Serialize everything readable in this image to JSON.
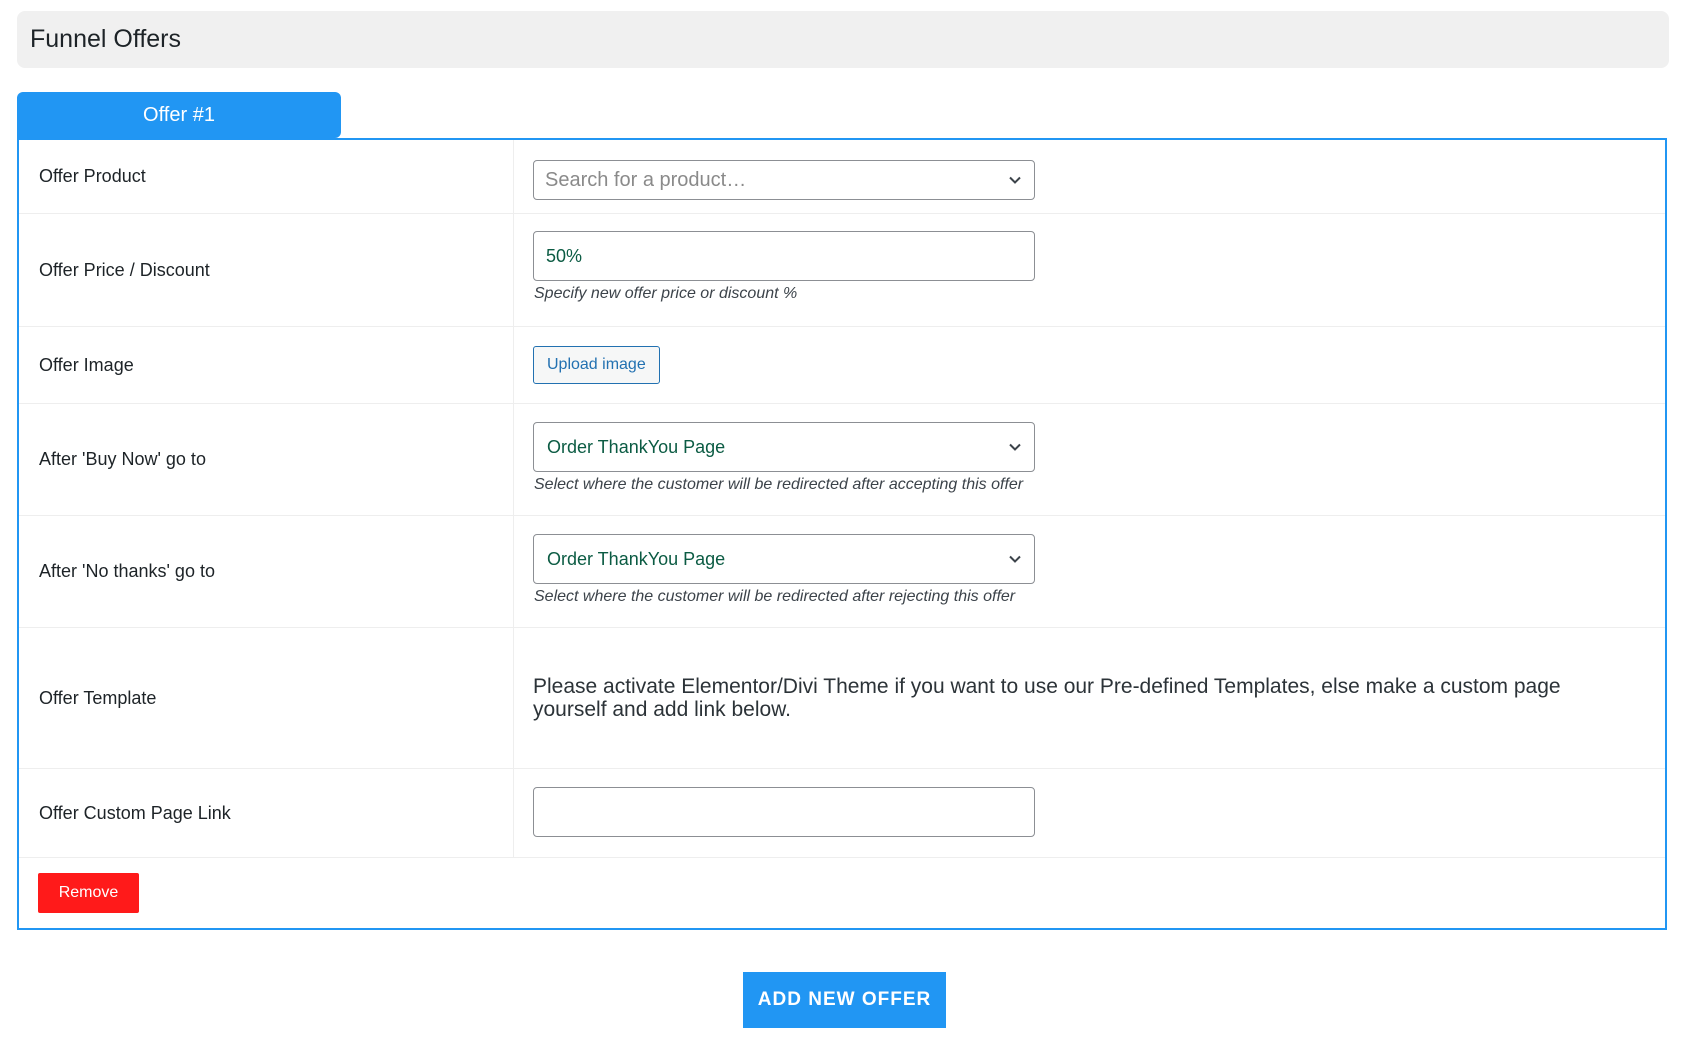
{
  "header": {
    "title": "Funnel Offers"
  },
  "tab": {
    "label": "Offer #1"
  },
  "rows": {
    "product": {
      "label": "Offer Product",
      "placeholder": "Search for a product…"
    },
    "price": {
      "label": "Offer Price / Discount",
      "value": "50%",
      "hint": "Specify new offer price or discount %"
    },
    "image": {
      "label": "Offer Image",
      "button": "Upload image"
    },
    "buy_now": {
      "label": "After 'Buy Now' go to",
      "value": "Order ThankYou Page",
      "hint": "Select where the customer will be redirected after accepting this offer"
    },
    "no_thanks": {
      "label": "After 'No thanks' go to",
      "value": "Order ThankYou Page",
      "hint": "Select where the customer will be redirected after rejecting this offer"
    },
    "template": {
      "label": "Offer Template",
      "note": "Please activate Elementor/Divi Theme if you want to use our Pre-defined Templates, else make a custom page yourself and add link below."
    },
    "custom_link": {
      "label": "Offer Custom Page Link",
      "value": ""
    }
  },
  "buttons": {
    "remove": "Remove",
    "add_new": "ADD NEW OFFER"
  },
  "icons": {
    "dropdown": "chevron-down-icon"
  },
  "colors": {
    "accent": "#2196f3",
    "danger": "#ff1a1a",
    "value_text": "#0b5b43"
  }
}
